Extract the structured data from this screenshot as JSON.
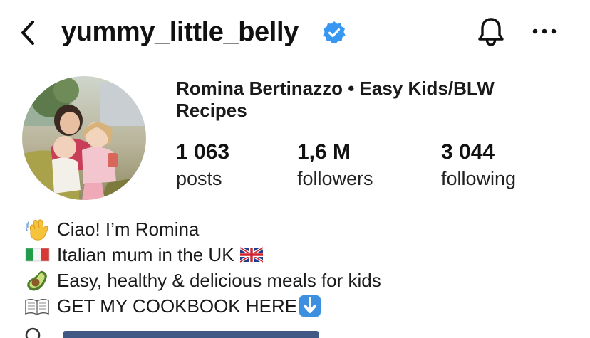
{
  "header": {
    "username": "yummy_little_belly",
    "verified": true,
    "icons": {
      "back": "chevron-left-icon",
      "verified": "verified-badge-icon",
      "notifications": "bell-icon",
      "more": "more-horizontal-icon"
    }
  },
  "profile": {
    "full_name": "Romina Bertinazzo • Easy Kids/BLW Recipes",
    "stats": [
      {
        "value": "1 063",
        "label": "posts"
      },
      {
        "value": "1,6 M",
        "label": "followers"
      },
      {
        "value": "3 044",
        "label": "following"
      }
    ]
  },
  "bio": {
    "lines": [
      {
        "emoji": "waving-hand-icon",
        "text": "Ciao! I’m Romina"
      },
      {
        "emoji": "italy-flag-icon",
        "text": "Italian mum in the UK",
        "trailing_emoji": "uk-flag-icon"
      },
      {
        "emoji": "avocado-icon",
        "text": "Easy, healthy & delicious meals for kids"
      },
      {
        "emoji": "open-book-icon",
        "text": "GET MY COOKBOOK HERE",
        "trailing_emoji": "down-arrow-button-icon"
      }
    ]
  },
  "colors": {
    "verified_blue": "#3897F0",
    "text": "#111111",
    "background": "#FFFFFF"
  }
}
